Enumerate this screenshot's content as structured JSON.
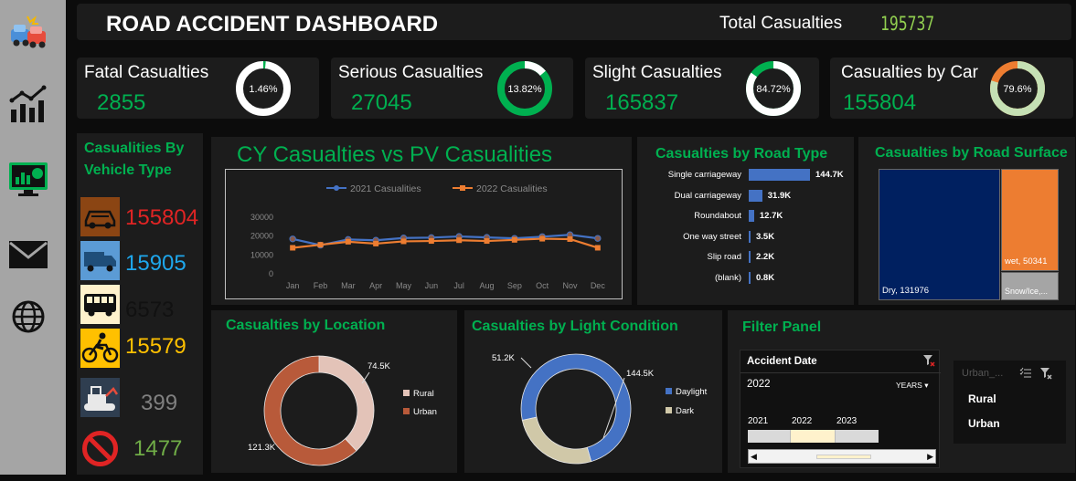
{
  "header": {
    "title": "ROAD ACCIDENT DASHBOARD",
    "total_label": "Total Casualties",
    "total_value": "195737"
  },
  "kpis": [
    {
      "label": "Fatal Casualties",
      "value": "2855",
      "pct_label": "1.46%",
      "pct": 1.46,
      "color": "#00b050",
      "track": "#ffffff"
    },
    {
      "label": "Serious Casualties",
      "value": "27045",
      "pct_label": "13.82%",
      "pct": 13.82,
      "color": "#ffffff",
      "track": "#00b050"
    },
    {
      "label": "Slight Casualties",
      "value": "165837",
      "pct_label": "84.72%",
      "pct": 84.72,
      "color": "#ffffff",
      "track": "#00b050"
    },
    {
      "label": "Casualties by Car",
      "value": "155804",
      "pct_label": "79.6%",
      "pct": 79.6,
      "color": "#c5e0b4",
      "track": "#ed7d31"
    }
  ],
  "vehicle": {
    "title_line1": "Casualities By",
    "title_line2": "Vehicle Type",
    "items": [
      {
        "icon": "car-icon",
        "value": "155804",
        "color": "#e02424"
      },
      {
        "icon": "truck-icon",
        "value": "15905",
        "color": "#1ea7ec"
      },
      {
        "icon": "bus-icon",
        "value": "6573",
        "color": "#111111"
      },
      {
        "icon": "bicycle-icon",
        "value": "15579",
        "color": "#ffc000"
      },
      {
        "icon": "agricultural-vehicle-icon",
        "value": "399",
        "color": "#808080"
      },
      {
        "icon": "other-vehicle-icon",
        "value": "1477",
        "color": "#70ad47"
      }
    ]
  },
  "chart_data": [
    {
      "type": "line",
      "title": "CY Casualties vs PV Casualities",
      "categories": [
        "Jan",
        "Feb",
        "Mar",
        "Apr",
        "May",
        "Jun",
        "Jul",
        "Aug",
        "Sep",
        "Oct",
        "Nov",
        "Dec"
      ],
      "ylim": [
        0,
        30000
      ],
      "yticks": [
        "30000",
        "20000",
        "10000",
        "0"
      ],
      "legend": "top",
      "grid": false,
      "series": [
        {
          "name": "2021 Casualities",
          "color": "#4472c4",
          "values": [
            18500,
            15200,
            18200,
            17800,
            19000,
            19200,
            19800,
            19300,
            18800,
            19700,
            20700,
            18800
          ]
        },
        {
          "name": "2022 Casualities",
          "color": "#ed7d31",
          "values": [
            13800,
            15400,
            17000,
            16000,
            17200,
            17400,
            17800,
            17400,
            18000,
            18600,
            18400,
            13800
          ]
        }
      ]
    },
    {
      "type": "bar",
      "title": "Casualties by Road Type",
      "categories": [
        "Single carriageway",
        "Dual carriageway",
        "Roundabout",
        "One way street",
        "Slip road",
        "(blank)"
      ],
      "values": [
        144.7,
        31.9,
        12.7,
        3.5,
        2.2,
        0.8
      ],
      "labels": [
        "144.7K",
        "31.9K",
        "12.7K",
        "3.5K",
        "2.2K",
        "0.8K"
      ],
      "color": "#4472c4"
    },
    {
      "type": "treemap",
      "title": "Casualties by Road Surface",
      "items": [
        {
          "name": "Dry",
          "value": 131976,
          "label": "Dry, 131976",
          "color": "#002060"
        },
        {
          "name": "wet",
          "value": 50341,
          "label": "wet, 50341",
          "color": "#ed7d31"
        },
        {
          "name": "Snow/Ice",
          "value": 13420,
          "label": "Snow/Ice,...",
          "color": "#a5a5a5"
        }
      ]
    },
    {
      "type": "pie",
      "title": "Casualties by Location",
      "legend": "right",
      "series": [
        {
          "name": "Rural",
          "value": 74.5,
          "label": "74.5K",
          "color": "#e3c3b8"
        },
        {
          "name": "Urban",
          "value": 121.3,
          "label": "121.3K",
          "color": "#b85a3a"
        }
      ]
    },
    {
      "type": "pie",
      "title": "Casualties by Light Condition",
      "legend": "right",
      "series": [
        {
          "name": "Daylight",
          "value": 144.5,
          "label": "144.5K",
          "color": "#4472c4"
        },
        {
          "name": "Dark",
          "value": 51.2,
          "label": "51.2K",
          "color": "#d0c8a8"
        }
      ]
    }
  ],
  "filter": {
    "title": "Filter Panel",
    "date_title": "Accident Date",
    "date_value": "2022",
    "years_label": "YEARS",
    "years": [
      "2021",
      "2022",
      "2023"
    ],
    "location_title": "Urban_...",
    "location_items": [
      "Rural",
      "Urban"
    ]
  }
}
